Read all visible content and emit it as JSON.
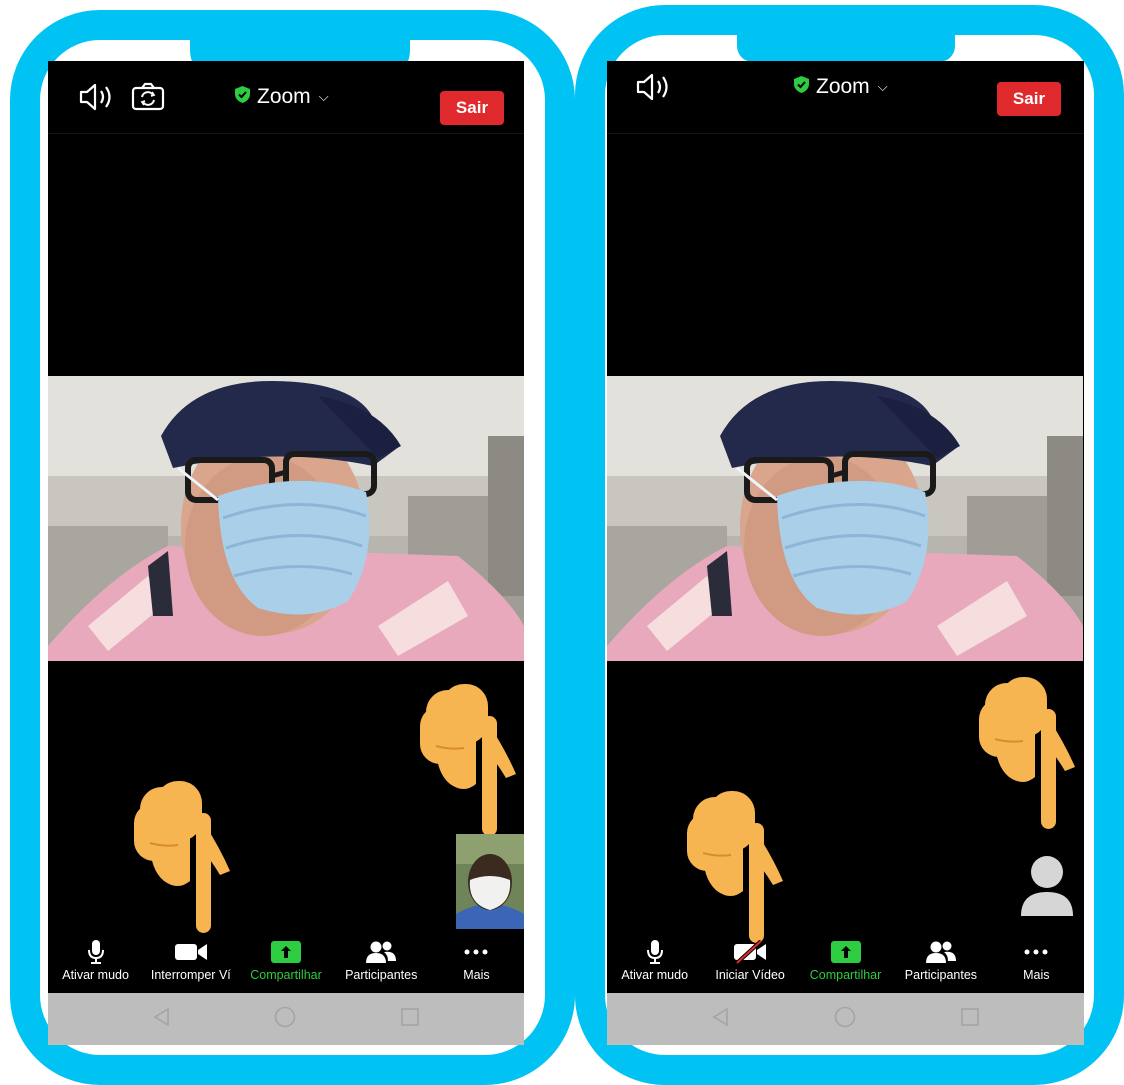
{
  "colors": {
    "frame": "#00c2f3",
    "leave": "#e0292c",
    "share": "#2ecc40",
    "hand": "#f7b552",
    "nav_bar": "#bdbdbd"
  },
  "phones": [
    {
      "top_bar": {
        "icons": [
          "speaker-icon",
          "switch-camera-icon"
        ],
        "title": "Zoom",
        "leave_label": "Sair"
      },
      "toolbar": [
        {
          "icon": "microphone-icon",
          "label": "Ativar mudo"
        },
        {
          "icon": "video-camera-icon",
          "label": "Interromper Ví"
        },
        {
          "icon": "share-screen-icon",
          "label": "Compartilhar"
        },
        {
          "icon": "participants-icon",
          "label": "Participantes"
        },
        {
          "icon": "more-icon",
          "label": "Mais"
        }
      ],
      "self_view": "camera-preview-thumbnail",
      "pointing_hands": 2
    },
    {
      "top_bar": {
        "icons": [
          "speaker-icon"
        ],
        "title": "Zoom",
        "leave_label": "Sair"
      },
      "toolbar": [
        {
          "icon": "microphone-icon",
          "label": "Ativar mudo"
        },
        {
          "icon": "video-off-icon",
          "label": "Iniciar Vídeo"
        },
        {
          "icon": "share-screen-icon",
          "label": "Compartilhar"
        },
        {
          "icon": "participants-icon",
          "label": "Participantes"
        },
        {
          "icon": "more-icon",
          "label": "Mais"
        }
      ],
      "self_view": "avatar-placeholder-icon",
      "pointing_hands": 2
    }
  ],
  "android_nav": [
    "back-icon",
    "home-icon",
    "recents-icon"
  ]
}
